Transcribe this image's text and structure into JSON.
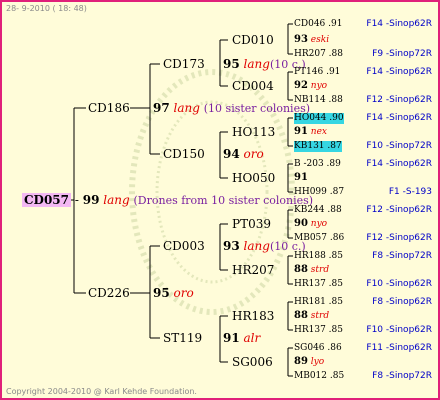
{
  "header": "28- 9-2010 ( 18: 48)",
  "footer": "Copyright 2004-2010 @ Karl Kehde Foundation.",
  "root": {
    "id": "CD057",
    "year": "99",
    "tag": "lang",
    "note": "(Drones from 10 sister colonies)"
  },
  "parents": {
    "upper": {
      "id": "CD186",
      "year": "97",
      "tag": "lang",
      "note": "(10 sister colonies)"
    },
    "lower": {
      "id": "CD226",
      "year": "95",
      "tag": "oro"
    }
  },
  "grandparents": [
    {
      "id": "CD173",
      "year": "95",
      "tag": "lang",
      "note": "(10 c.)"
    },
    {
      "id": "CD150",
      "year": "94",
      "tag": "oro"
    },
    {
      "id": "CD003",
      "year": "93",
      "tag": "lang",
      "note": "(10 c.)"
    },
    {
      "id": "ST119",
      "year": "91",
      "tag": "alr"
    }
  ],
  "great_grandparents": [
    {
      "id": "CD010",
      "year": "93",
      "tag": "eski"
    },
    {
      "id": "CD004",
      "year": "92",
      "tag": "nyo"
    },
    {
      "id": "HO113",
      "year": "91",
      "tag": "nex"
    },
    {
      "id": "HO050",
      "year": "91",
      "tag": ""
    },
    {
      "id": "PT039",
      "year": "90",
      "tag": "nyo"
    },
    {
      "id": "HR207",
      "year": "88",
      "tag": "strd"
    },
    {
      "id": "HR183",
      "year": "88",
      "tag": "strd"
    },
    {
      "id": "SG006",
      "year": "89",
      "tag": "lyo"
    }
  ],
  "leaves": [
    {
      "id": "CD046 .91",
      "loc": "F14 -Sinop62R"
    },
    {
      "id": "HR207 .88",
      "loc": "F9 -Sinop72R"
    },
    {
      "id": "PT146 .91",
      "loc": "F14 -Sinop62R"
    },
    {
      "id": "NB114 .88",
      "loc": "F12 -Sinop62R"
    },
    {
      "id": "HO044 .90",
      "loc": "F14 -Sinop62R"
    },
    {
      "id": "KB131 .87",
      "loc": "F10 -Sinop72R"
    },
    {
      "id": "B -203 .89",
      "loc": "F14 -Sinop62R"
    },
    {
      "id": "HH099 .87",
      "loc": "F1 -S-193"
    },
    {
      "id": "KB244 .88",
      "loc": "F12 -Sinop62R"
    },
    {
      "id": "MB057 .86",
      "loc": "F12 -Sinop62R"
    },
    {
      "id": "HR188 .85",
      "loc": "F8 -Sinop72R"
    },
    {
      "id": "HR137 .85",
      "loc": "F10 -Sinop62R"
    },
    {
      "id": "HR181 .85",
      "loc": "F8 -Sinop62R"
    },
    {
      "id": "HR137 .85",
      "loc": "F10 -Sinop62R"
    },
    {
      "id": "SG046 .86",
      "loc": "F11 -Sinop62R"
    },
    {
      "id": "MB012 .85",
      "loc": "F8 -Sinop72R"
    }
  ]
}
